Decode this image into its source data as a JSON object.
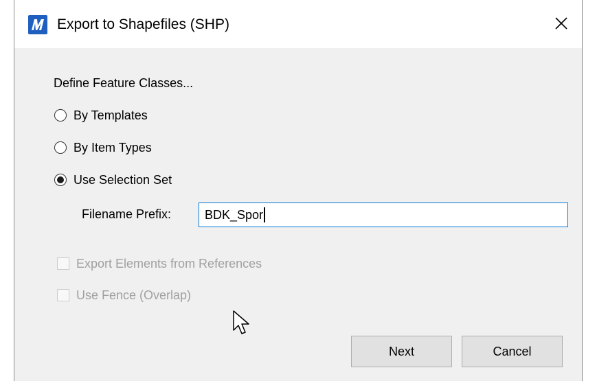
{
  "window": {
    "title": "Export to Shapefiles (SHP)",
    "app_icon": "microstation-icon",
    "close_icon": "close-icon"
  },
  "define": {
    "label": "Define Feature Classes...",
    "options": [
      {
        "label": "By Templates",
        "selected": false
      },
      {
        "label": "By Item Types",
        "selected": false
      },
      {
        "label": "Use Selection Set",
        "selected": true
      }
    ]
  },
  "prefix": {
    "label": "Filename Prefix:",
    "value": "BDK_Spor"
  },
  "checks": [
    {
      "label": "Export Elements from References",
      "checked": false,
      "enabled": false
    },
    {
      "label": "Use Fence (Overlap)",
      "checked": false,
      "enabled": false
    }
  ],
  "buttons": {
    "next": "Next",
    "cancel": "Cancel"
  },
  "colors": {
    "accent": "#0078d7",
    "icon_blue": "#1f5fbf",
    "disabled_text": "#a0a0a0"
  }
}
